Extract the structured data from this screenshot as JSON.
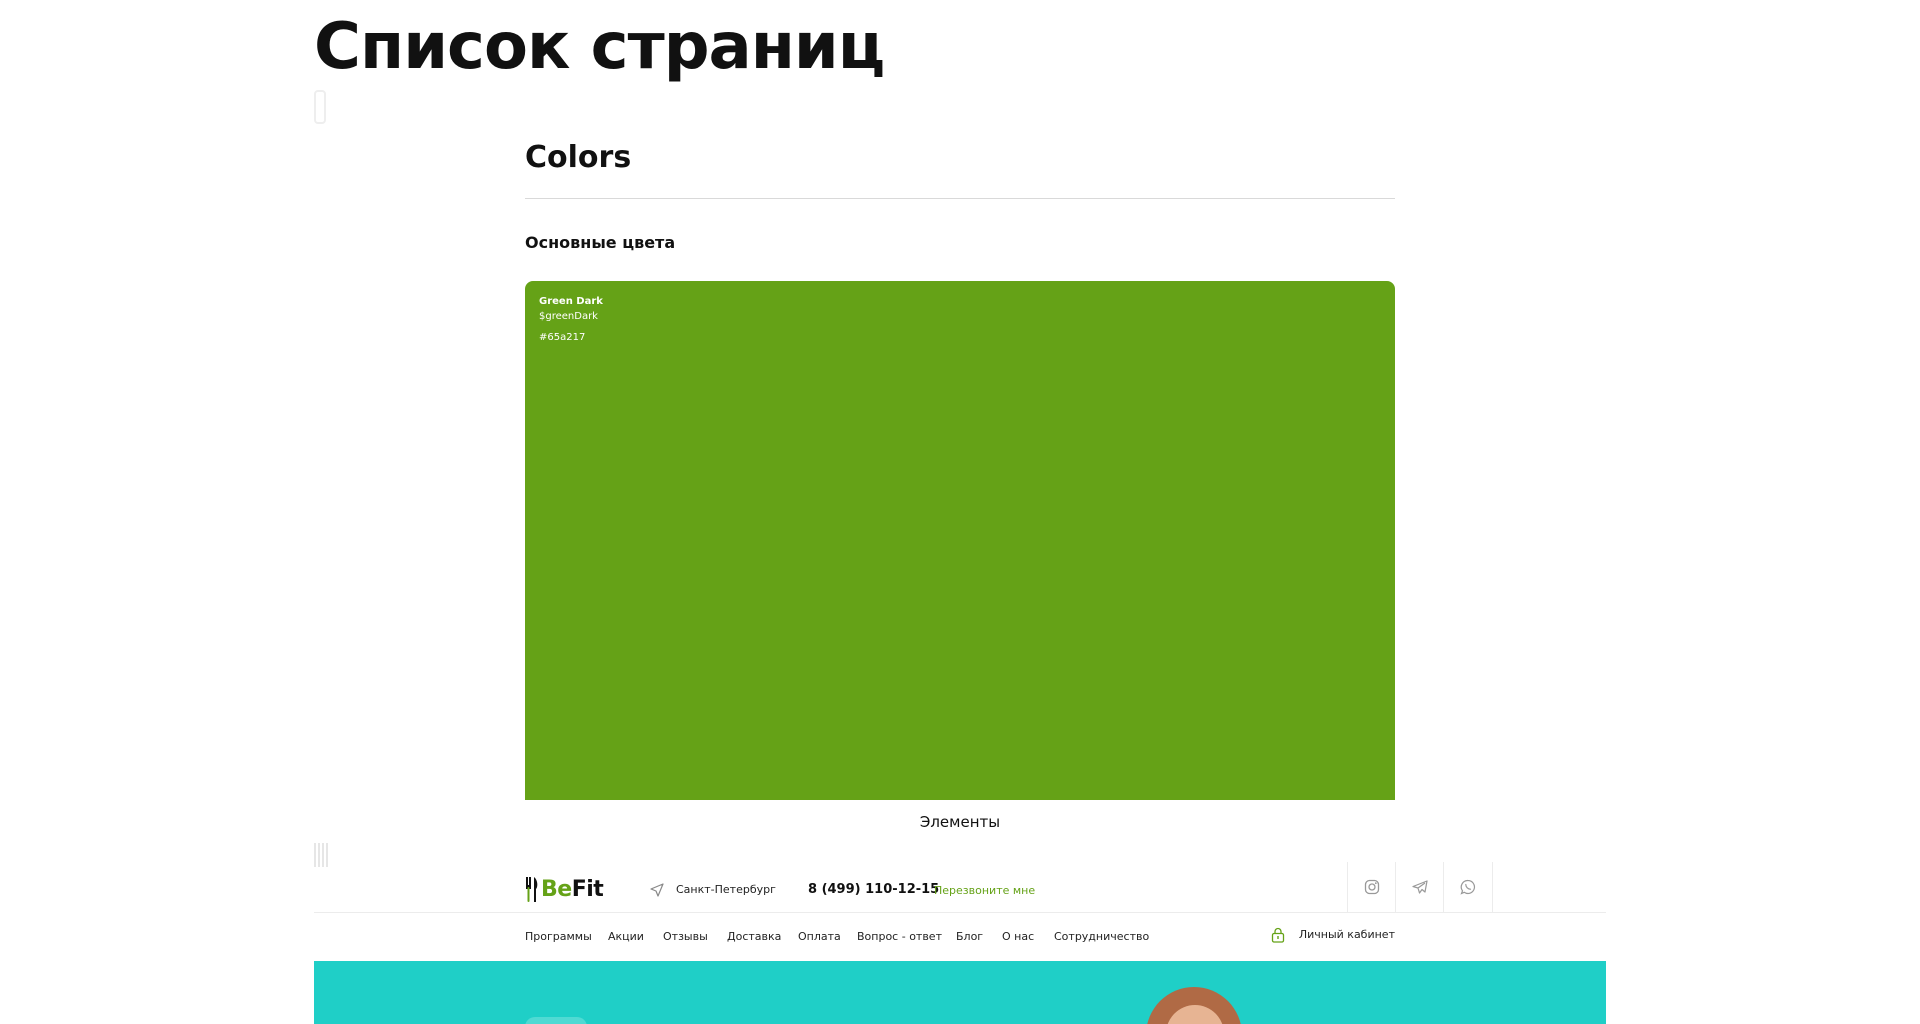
{
  "page": {
    "title": "Список страниц"
  },
  "colors_section": {
    "title": "Colors",
    "subtitle": "Основные цвета",
    "swatch": {
      "name": "Green Dark",
      "variable": "$greenDark",
      "hex_label": "#65a217",
      "color": "#65a217"
    }
  },
  "elements_label": "Элементы",
  "header_preview": {
    "logo": {
      "part1": "Be",
      "part2": "Fit",
      "icon": "fork-knife-logo-icon"
    },
    "city": "Санкт-Петербург",
    "city_icon": "location-arrow-icon",
    "phone": "8 (499) 110-12-15",
    "callback": "Перезвоните мне",
    "social": [
      {
        "icon": "instagram-icon"
      },
      {
        "icon": "telegram-icon"
      },
      {
        "icon": "whatsapp-icon"
      }
    ],
    "nav": [
      {
        "label": "Программы"
      },
      {
        "label": "Акции"
      },
      {
        "label": "Отзывы"
      },
      {
        "label": "Доставка"
      },
      {
        "label": "Оплата"
      },
      {
        "label": "Вопрос - ответ"
      },
      {
        "label": "Блог"
      },
      {
        "label": "О нас"
      },
      {
        "label": "Сотрудничество"
      }
    ],
    "cabinet": {
      "label": "Личный кабинет",
      "icon": "lock-icon"
    },
    "hero_color": "#1fcfc7"
  }
}
